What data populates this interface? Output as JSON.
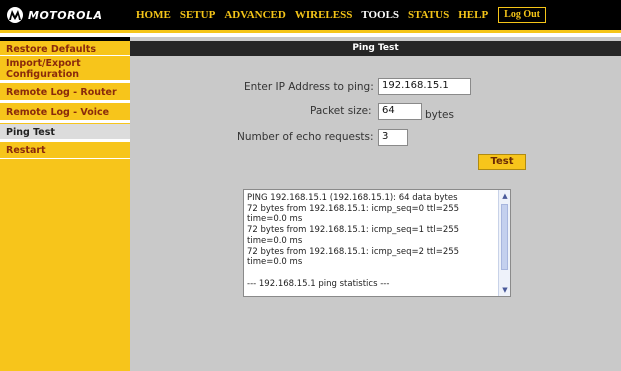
{
  "brand": {
    "name": "MOTOROLA",
    "logo_icon": "motorola-batwing-icon"
  },
  "nav": {
    "items": [
      {
        "label": "HOME"
      },
      {
        "label": "SETUP"
      },
      {
        "label": "ADVANCED"
      },
      {
        "label": "WIRELESS"
      },
      {
        "label": "TOOLS",
        "active": true
      },
      {
        "label": "STATUS"
      },
      {
        "label": "HELP"
      }
    ],
    "logout_label": "Log Out"
  },
  "sidebar": {
    "items": [
      {
        "label": "Restore Defaults"
      },
      {
        "label": "Import/Export Configuration"
      },
      {
        "label": "Remote Log - Router"
      },
      {
        "label": "Remote Log - Voice"
      },
      {
        "label": "Ping Test",
        "active": true
      },
      {
        "label": "Restart"
      }
    ]
  },
  "main": {
    "title": "Ping Test",
    "ip_label": "Enter IP Address to ping:",
    "ip_value": "192.168.15.1",
    "size_label": "Packet size:",
    "size_value": "64",
    "size_unit": "bytes",
    "count_label": "Number of echo requests:",
    "count_value": "3",
    "test_button": "Test",
    "output_text": "PING 192.168.15.1 (192.168.15.1): 64 data bytes\n72 bytes from 192.168.15.1: icmp_seq=0 ttl=255\ntime=0.0 ms\n72 bytes from 192.168.15.1: icmp_seq=1 ttl=255\ntime=0.0 ms\n72 bytes from 192.168.15.1: icmp_seq=2 ttl=255\ntime=0.0 ms\n\n--- 192.168.15.1 ping statistics ---"
  },
  "colors": {
    "accent": "#f7c51b",
    "topbar": "#000000",
    "content_bg": "#c9c9c9",
    "sidebar_text": "#8a2a0b"
  }
}
